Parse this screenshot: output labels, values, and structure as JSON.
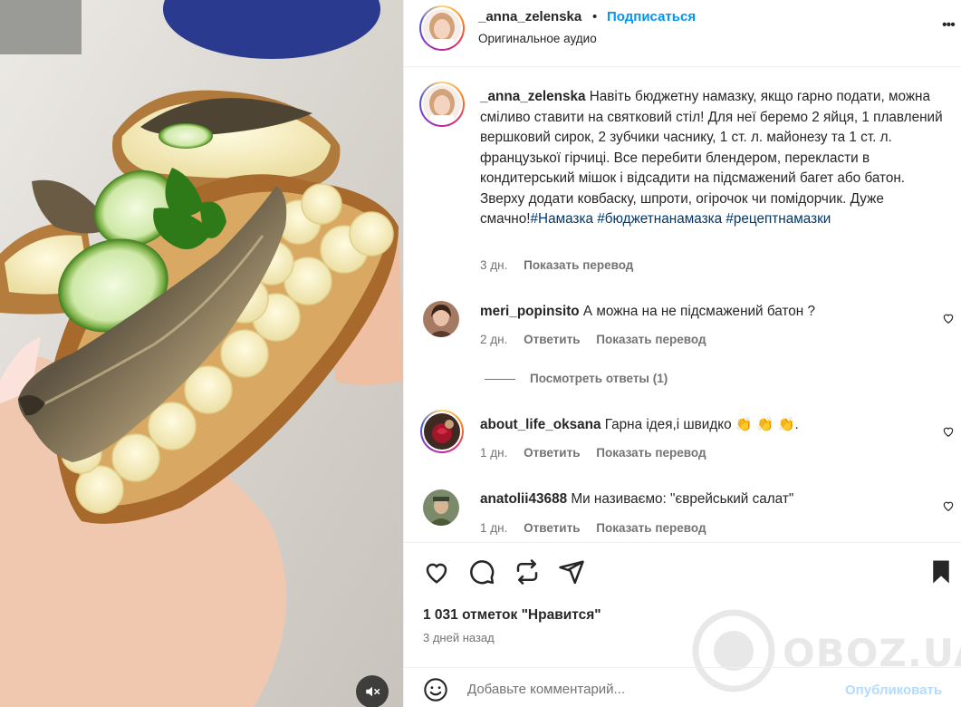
{
  "post": {
    "username": "_anna_zelenska",
    "dot": "•",
    "follow_label": "Подписаться",
    "audio_label": "Оригинальное аудио",
    "more_label": "•••"
  },
  "caption": {
    "username": "_anna_zelenska",
    "text": "Навіть бюджетну намазку, якщо гарно подати, можна сміливо ставити на святковий стіл! Для неї беремо 2 яйця, 1 плавлений вершковий сирок, 2 зубчики часнику, 1 ст. л. майонезу та 1 ст. л. французької гірчиці. Все перебити блендером, перекласти в кондитерський мішок і відсадити на підсмажений багет або батон. Зверху додати ковбаску, шпроти, огірочок чи помідорчик. Дуже смачно!",
    "hashtags": [
      "#Намазка",
      "#бюджетнанамазка",
      "#рецептнамазки"
    ],
    "time": "3 дн.",
    "translate_label": "Показать перевод"
  },
  "comments": [
    {
      "username": "meri_popinsito",
      "text": "А можна на не підсмажений батон ?",
      "time": "2 дн.",
      "reply_label": "Ответить",
      "translate_label": "Показать перевод",
      "view_replies": "Посмотреть ответы (1)"
    },
    {
      "username": "about_life_oksana",
      "text": "Гарна ідея,і швидко 👏 👏 👏.",
      "time": "1 дн.",
      "reply_label": "Ответить",
      "translate_label": "Показать перевод"
    },
    {
      "username": "anatolii43688",
      "text": "Ми називаємо: \"єврейський салат\"",
      "time": "1 дн.",
      "reply_label": "Ответить",
      "translate_label": "Показать перевод"
    }
  ],
  "likes_label": "1 031 отметок \"Нравится\"",
  "posted_ago": "3 дней назад",
  "add_comment": {
    "placeholder": "Добавьте комментарий...",
    "publish_label": "Опубликовать"
  },
  "watermark": "OBOZ.UA",
  "icons": {
    "like": "heart-icon",
    "comment": "comment-bubble-icon",
    "repost": "repost-icon",
    "share": "send-icon",
    "save": "bookmark-icon",
    "emoji": "emoji-icon",
    "mute": "speaker-muted-icon"
  },
  "colors": {
    "link_blue": "#0095f6",
    "hashtag_blue": "#00376b",
    "muted_text": "#737373",
    "publish_disabled": "#b3dbff"
  }
}
